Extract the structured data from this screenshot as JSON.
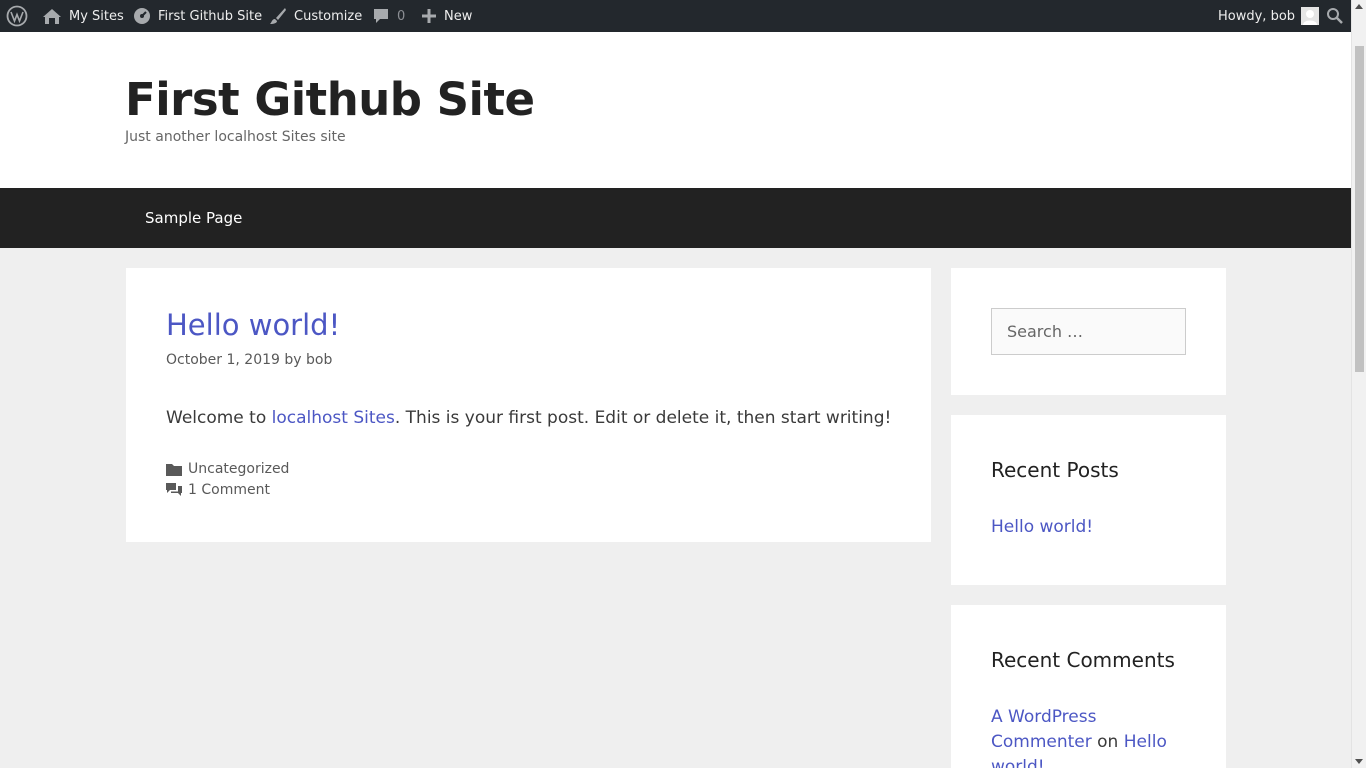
{
  "admin_bar": {
    "my_sites": "My Sites",
    "site_name": "First Github Site",
    "customize": "Customize",
    "comments_count": "0",
    "new": "New",
    "howdy": "Howdy, bob"
  },
  "header": {
    "title": "First Github Site",
    "tagline": "Just another localhost Sites site"
  },
  "nav": {
    "items": [
      {
        "label": "Sample Page"
      }
    ]
  },
  "post": {
    "title": "Hello world!",
    "date": "October 1, 2019",
    "by": "by",
    "author": "bob",
    "body_before": "Welcome to ",
    "body_link": "localhost Sites",
    "body_after": ". This is your first post. Edit or delete it, then start writing!",
    "category": "Uncategorized",
    "comments": "1 Comment"
  },
  "sidebar": {
    "search_placeholder": "Search …",
    "recent_posts_title": "Recent Posts",
    "recent_posts": [
      {
        "label": "Hello world!"
      }
    ],
    "recent_comments_title": "Recent Comments",
    "recent_comment": {
      "author": "A WordPress Commenter",
      "on": "on",
      "post": "Hello world!"
    }
  },
  "colors": {
    "link": "#4c57c4",
    "admin_bar": "#23282d",
    "nav": "#222222"
  }
}
